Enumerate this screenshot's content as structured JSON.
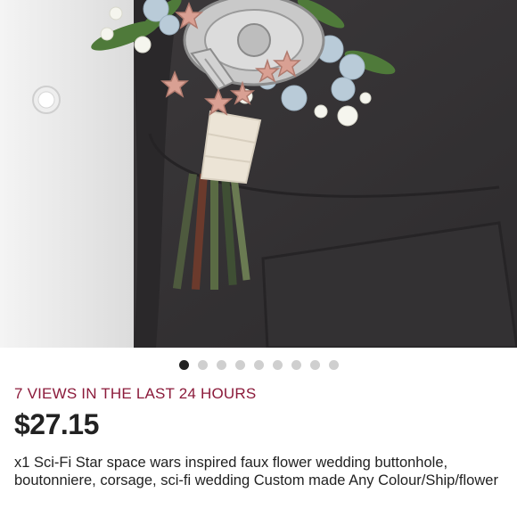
{
  "listing": {
    "views_text": "7 VIEWS IN THE LAST 24 HOURS",
    "price": "$27.15",
    "title": "x1 Sci-Fi Star space wars inspired faux flower wedding buttonhole, boutonniere, corsage, sci-fi wedding Custom made Any Colour/Ship/flower"
  },
  "carousel": {
    "image_count": 9,
    "active_index": 1
  },
  "photo": {
    "icon": "boutonniere-photo"
  },
  "colors": {
    "views_accent": "#8b1a3a",
    "price": "#222222",
    "dot_active": "#222222",
    "dot_inactive": "#cfcfcf"
  }
}
